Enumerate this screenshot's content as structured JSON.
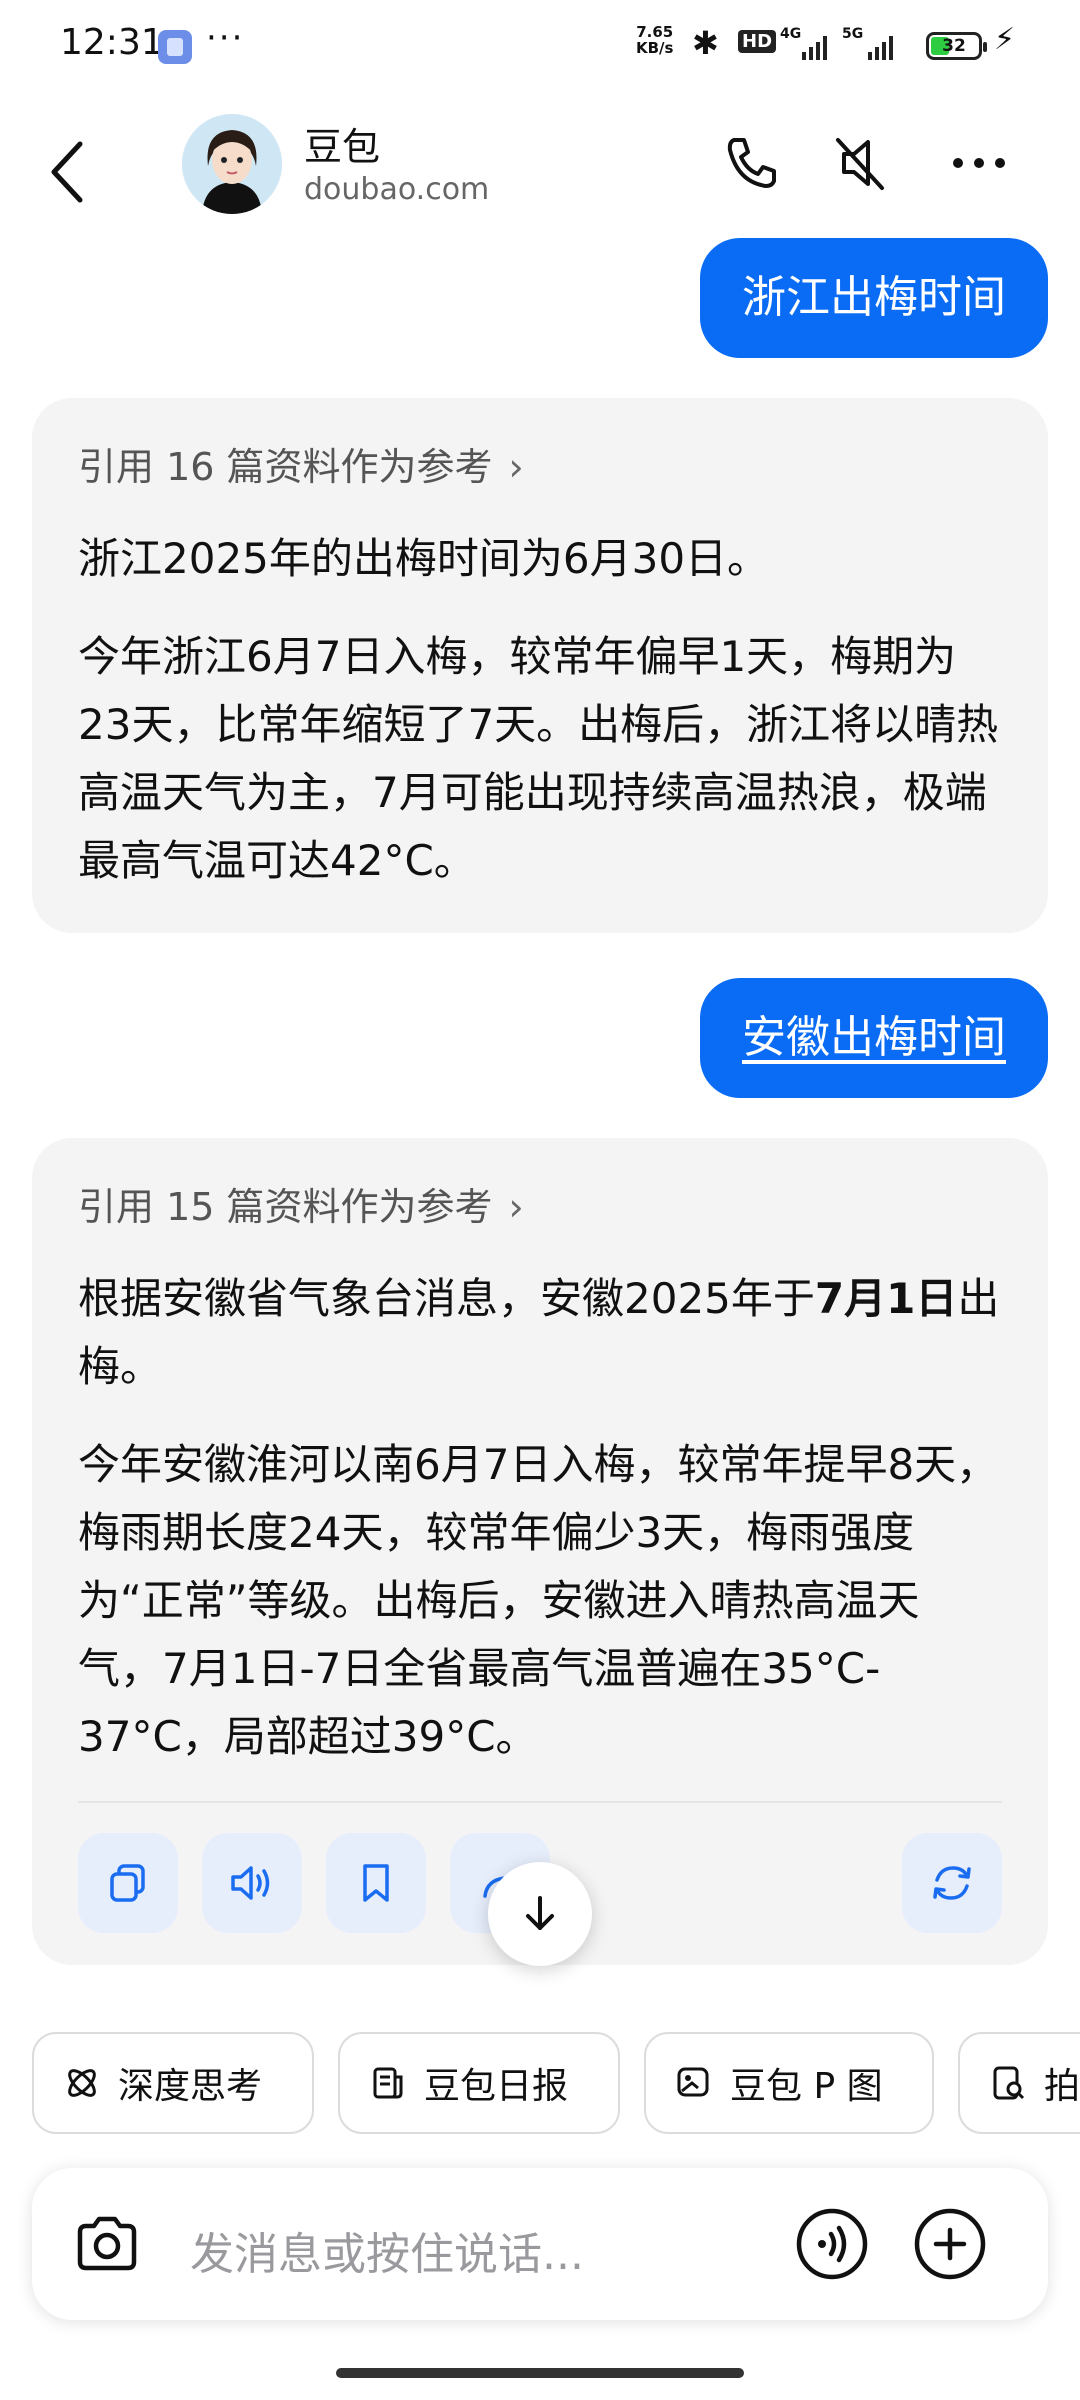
{
  "status_bar": {
    "time": "12:31",
    "more": "···",
    "net_speed_value": "7.65",
    "net_speed_unit": "KB/s",
    "hd": "HD",
    "sig1": "4G",
    "sig2": "5G",
    "battery": "32"
  },
  "header": {
    "name": "豆包",
    "domain": "doubao.com"
  },
  "messages": [
    {
      "role": "user",
      "text": "浙江出梅时间"
    },
    {
      "role": "assistant",
      "refs": "引用 16 篇资料作为参考",
      "paragraphs": [
        "浙江2025年的出梅时间为6月30日。",
        "今年浙江6月7日入梅，较常年偏早1天，梅期为23天，比常年缩短了7天。出梅后，浙江将以晴热高温天气为主，7月可能出现持续高温热浪，极端最高气温可达42°C。"
      ]
    },
    {
      "role": "user",
      "text": "安徽出梅时间"
    },
    {
      "role": "assistant",
      "refs": "引用 15 篇资料作为参考",
      "p1_a": "根据安徽省气象台消息，安徽2025年于",
      "p1_bold": "7月1日",
      "p1_b": "出梅。",
      "p2": "今年安徽淮河以南6月7日入梅，较常年提早8天，梅雨期长度24天，较常年偏少3天，梅雨强度为“正常”等级。出梅后，安徽进入晴热高温天气，7月1日-7日全省最高气温普遍在35°C-37°C，局部超过39°C。"
    }
  ],
  "chips": [
    "深度思考",
    "豆包日报",
    "豆包 P 图",
    "拍"
  ],
  "input": {
    "placeholder": "发消息或按住说话..."
  },
  "colors": {
    "accent": "#0a6cf5",
    "assistant_bg": "#f4f4f5",
    "action_bg": "#e6edfb"
  }
}
